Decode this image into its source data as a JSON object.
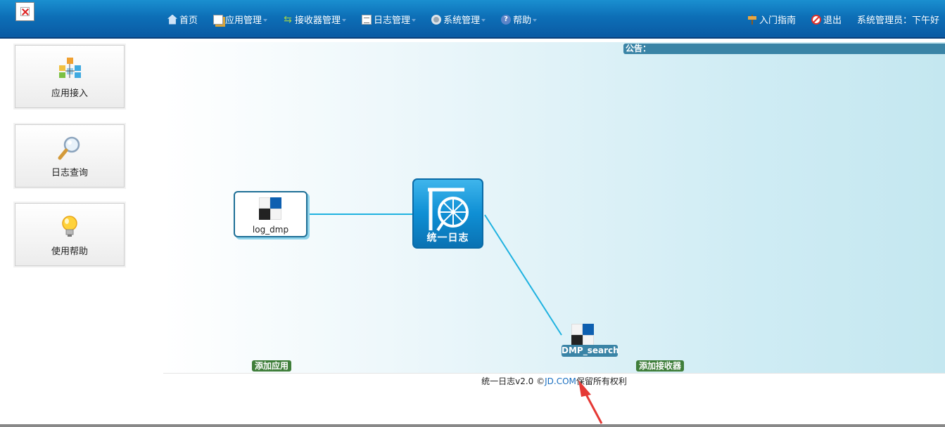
{
  "nav": {
    "menu": [
      {
        "label": "首页",
        "icon": "home-icon"
      },
      {
        "label": "应用管理",
        "icon": "app-icon"
      },
      {
        "label": "接收器管理",
        "icon": "receiver-icon"
      },
      {
        "label": "日志管理",
        "icon": "document-icon"
      },
      {
        "label": "系统管理",
        "icon": "gear-icon"
      },
      {
        "label": "帮助",
        "icon": "help-icon"
      }
    ],
    "guide": "入门指南",
    "logout": "退出",
    "admin": "系统管理员：下午好"
  },
  "sidebar": {
    "items": [
      {
        "label": "应用接入",
        "icon": "app-access-icon"
      },
      {
        "label": "日志查询",
        "icon": "magnifier-icon"
      },
      {
        "label": "使用帮助",
        "icon": "lightbulb-icon"
      }
    ]
  },
  "notice": {
    "label": "公告："
  },
  "diagram": {
    "app_node": "log_dmp",
    "hub_label": "统一日志",
    "receiver_node": "DMP_search",
    "add_app": "添加应用",
    "add_receiver": "添加接收器"
  },
  "footer": {
    "prefix": "统一日志v2.0 ©",
    "link": "JD.COM",
    "suffix": "保留所有权利"
  },
  "colors": {
    "nav_bg": "#0d6fb7",
    "accent": "#3a84a6",
    "tag_green": "#3f7e3a",
    "link": "#1a6fc0",
    "connector": "#1fb2e0",
    "arrow": "#e53935"
  }
}
